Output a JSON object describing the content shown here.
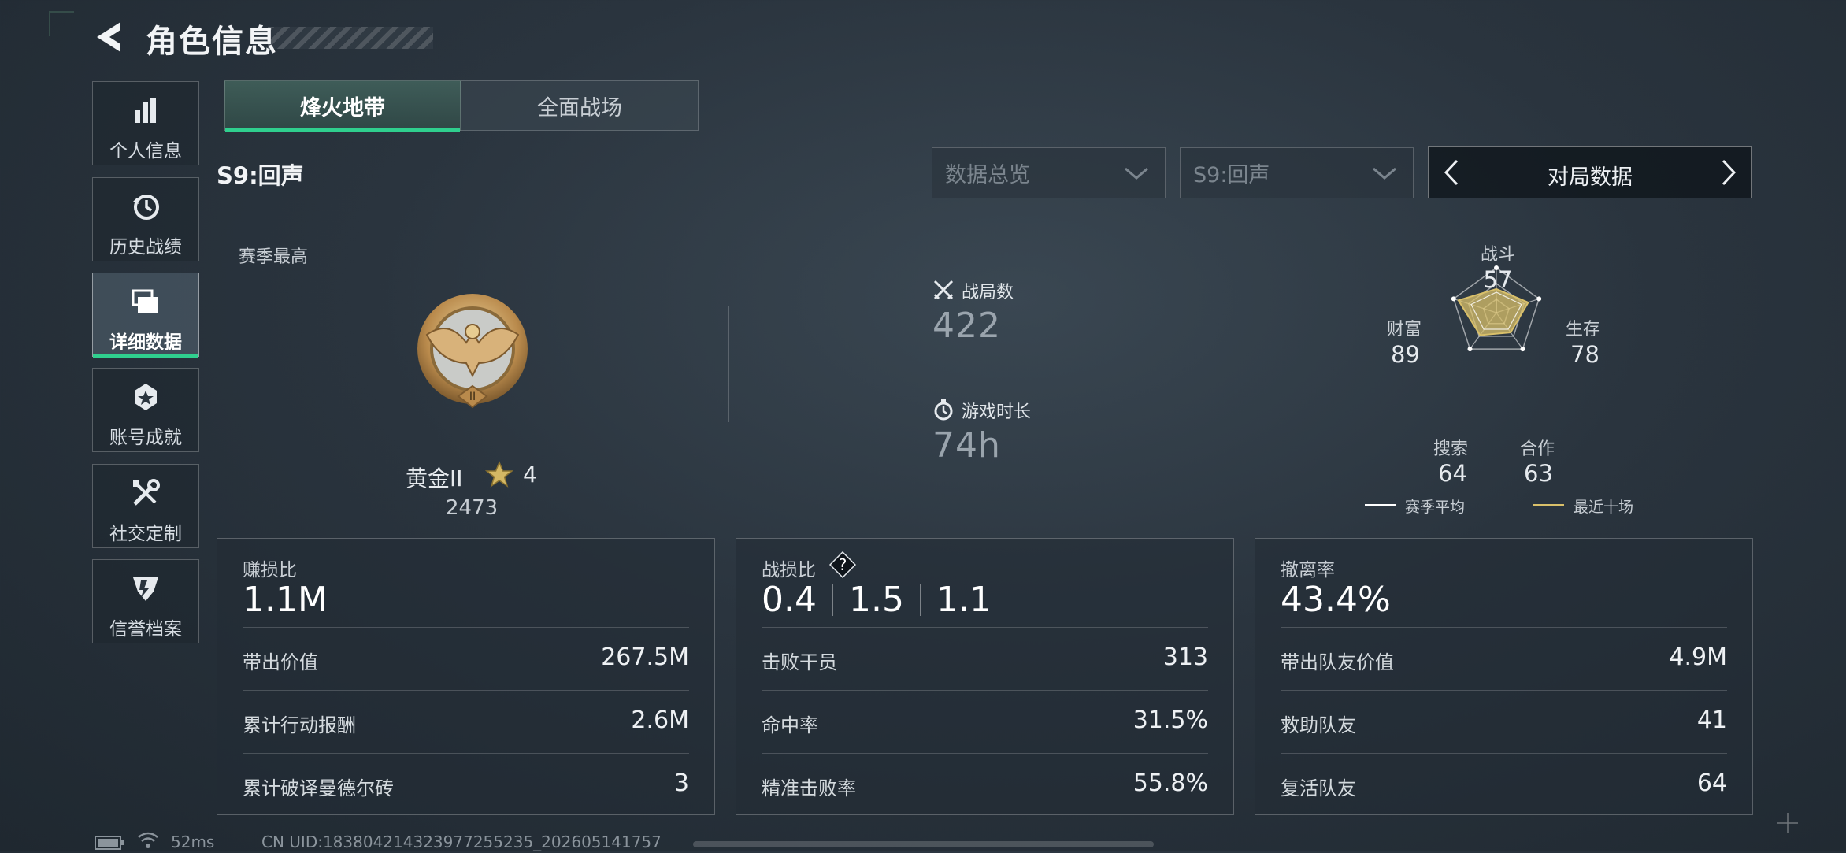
{
  "header": {
    "title": "角色信息"
  },
  "sidebar": {
    "items": [
      {
        "label": "个人信息",
        "icon": "bar-chart-icon"
      },
      {
        "label": "历史战绩",
        "icon": "history-clock-icon"
      },
      {
        "label": "详细数据",
        "icon": "folder-stack-icon",
        "active": true
      },
      {
        "label": "账号成就",
        "icon": "medal-icon"
      },
      {
        "label": "社交定制",
        "icon": "tools-icon"
      },
      {
        "label": "信誉档案",
        "icon": "shield-emblem-icon"
      }
    ]
  },
  "tabs": [
    {
      "label": "烽火地带",
      "active": true
    },
    {
      "label": "全面战场",
      "active": false
    }
  ],
  "season_label": "S9:回声",
  "filters": {
    "overview": "数据总览",
    "season": "S9:回声",
    "mode": "对局数据"
  },
  "season_best": {
    "label": "赛季最高",
    "rank": "黄金II",
    "stars": "4",
    "score": "2473"
  },
  "summary": {
    "matches_label": "战局数",
    "matches": "422",
    "playtime_label": "游戏时长",
    "playtime": "74h"
  },
  "radar": {
    "axes": [
      {
        "label": "战斗",
        "value": "57"
      },
      {
        "label": "生存",
        "value": "78"
      },
      {
        "label": "合作",
        "value": "63"
      },
      {
        "label": "搜索",
        "value": "64"
      },
      {
        "label": "财富",
        "value": "89"
      }
    ],
    "legend": [
      {
        "label": "赛季平均",
        "color": "#ffffff"
      },
      {
        "label": "最近十场",
        "color": "#d9c06a"
      }
    ]
  },
  "panels": [
    {
      "title": "赚损比",
      "big": "1.1M",
      "rows": [
        {
          "k": "带出价值",
          "v": "267.5M"
        },
        {
          "k": "累计行动报酬",
          "v": "2.6M"
        },
        {
          "k": "累计破译曼德尔砖",
          "v": "3"
        }
      ]
    },
    {
      "title": "战损比",
      "big_parts": [
        "0.4",
        "1.5",
        "1.1"
      ],
      "rows": [
        {
          "k": "击败干员",
          "v": "313"
        },
        {
          "k": "命中率",
          "v": "31.5%"
        },
        {
          "k": "精准击败率",
          "v": "55.8%"
        }
      ]
    },
    {
      "title": "撤离率",
      "big": "43.4%",
      "rows": [
        {
          "k": "带出队友价值",
          "v": "4.9M"
        },
        {
          "k": "救助队友",
          "v": "41"
        },
        {
          "k": "复活队友",
          "v": "64"
        }
      ]
    }
  ],
  "status": {
    "ping": "52ms",
    "uid": "CN UID:183804214323977255235_202605141757"
  },
  "colors": {
    "accent": "#2fcf8e",
    "gold": "#d9c06a"
  }
}
